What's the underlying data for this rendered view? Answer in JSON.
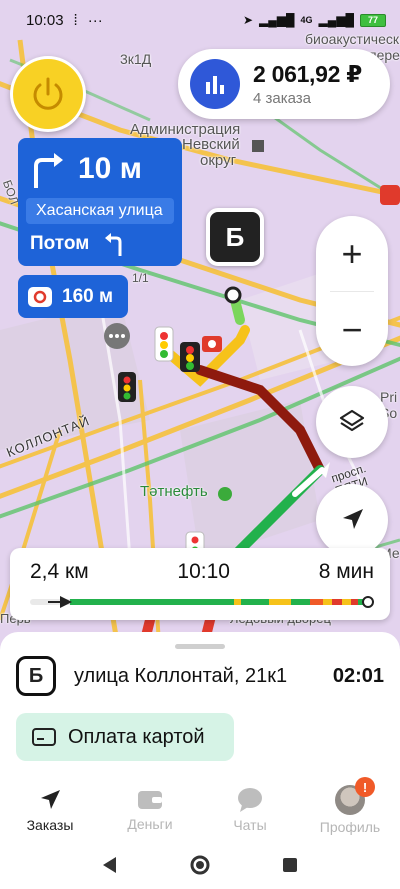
{
  "status_bar": {
    "time": "10:03",
    "network": "4G",
    "battery": "77"
  },
  "map": {
    "labels": {
      "bio": "биоакустические",
      "bio2": "спере",
      "building": "3к1Д",
      "admin_1": "Администрация",
      "admin_2": "Невский",
      "admin_3": "округ",
      "street_left": "БОЛ",
      "lot": "1/1",
      "kollontai": "КОЛЛОНТАЙ",
      "tatneft": "Тәтнефть",
      "prosp": "просп. ПЯТИ",
      "pri": "Pri",
      "so": "So",
      "me": "Ме",
      "dvorets": "Ледовый дворец",
      "pervy": "Перв"
    }
  },
  "earnings": {
    "amount": "2 061,92 ₽",
    "orders": "4 заказа"
  },
  "navigation": {
    "distance": "10 м",
    "street": "Хасанская улица",
    "then_label": "Потом"
  },
  "speed_camera": {
    "distance": "160 м"
  },
  "destination_marker": "Б",
  "zoom": {
    "plus": "+",
    "minus": "−"
  },
  "route_summary": {
    "distance": "2,4 км",
    "arrival_time": "10:10",
    "duration": "8 мин",
    "progress": 0.12,
    "traffic_segments": [
      {
        "share": 0.52,
        "color": "#22b14c"
      },
      {
        "share": 0.02,
        "color": "#f6c21a"
      },
      {
        "share": 0.09,
        "color": "#22b14c"
      },
      {
        "share": 0.07,
        "color": "#f6c21a"
      },
      {
        "share": 0.06,
        "color": "#22b14c"
      },
      {
        "share": 0.04,
        "color": "#f05a28"
      },
      {
        "share": 0.03,
        "color": "#f6c21a"
      },
      {
        "share": 0.03,
        "color": "#e03a2c"
      },
      {
        "share": 0.03,
        "color": "#f6c21a"
      },
      {
        "share": 0.02,
        "color": "#e03a2c"
      },
      {
        "share": 0.02,
        "color": "#22b14c"
      }
    ]
  },
  "order": {
    "point_letter": "Б",
    "address": "улица Коллонтай, 21к1",
    "eta": "02:01",
    "payment_label": "Оплата картой"
  },
  "tabs": [
    {
      "label": "Заказы",
      "icon": "navigation-arrow-icon",
      "active": true
    },
    {
      "label": "Деньги",
      "icon": "wallet-icon",
      "active": false
    },
    {
      "label": "Чаты",
      "icon": "chat-bubble-icon",
      "active": false
    },
    {
      "label": "Профиль",
      "icon": "avatar",
      "active": false,
      "badge": "!"
    }
  ],
  "colors": {
    "accent_blue": "#1e63d8",
    "power_yellow": "#f8d124",
    "payment_bg": "#d6f3e6",
    "badge_orange": "#f05a28"
  }
}
